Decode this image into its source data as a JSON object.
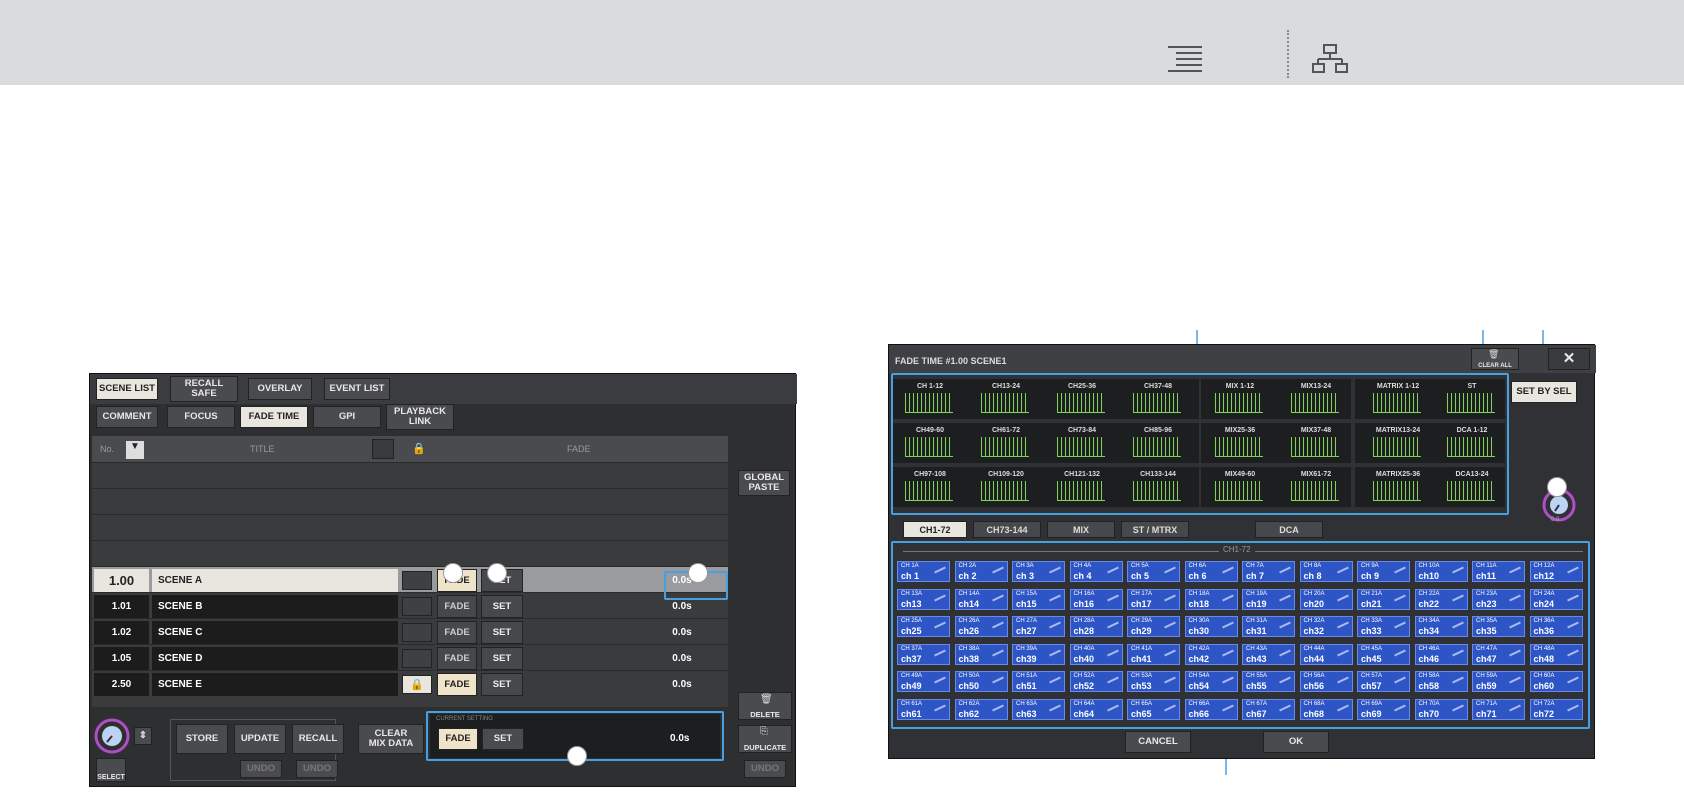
{
  "left": {
    "tabs": [
      "SCENE LIST",
      "RECALL\nSAFE",
      "OVERLAY",
      "EVENT LIST"
    ],
    "subtabs": [
      "COMMENT",
      "FOCUS",
      "FADE TIME",
      "GPI",
      "PLAYBACK\nLINK"
    ],
    "header": {
      "no": "No.",
      "title": "TITLE",
      "fade": "FADE"
    },
    "global_paste": "GLOBAL\nPASTE",
    "rows": [
      {
        "num": "1.00",
        "title": "SCENE A",
        "fade": "FADE",
        "set": "SET",
        "time": "0.0s"
      },
      {
        "num": "1.01",
        "title": "SCENE B",
        "fade": "FADE",
        "set": "SET",
        "time": "0.0s"
      },
      {
        "num": "1.02",
        "title": "SCENE C",
        "fade": "FADE",
        "set": "SET",
        "time": "0.0s"
      },
      {
        "num": "1.05",
        "title": "SCENE D",
        "fade": "FADE",
        "set": "SET",
        "time": "0.0s"
      },
      {
        "num": "2.50",
        "title": "SCENE E",
        "fade": "FADE",
        "set": "SET",
        "time": "0.0s"
      }
    ],
    "bottom": {
      "store": "STORE",
      "update": "UPDATE",
      "recall": "RECALL",
      "undo": "UNDO",
      "clear": "CLEAR\nMIX DATA",
      "current": "CURRENT SETTING",
      "fade": "FADE",
      "set": "SET",
      "time": "0.0s",
      "delete": "DELETE",
      "duplicate": "DUPLICATE",
      "select": "SELECT"
    }
  },
  "dialog": {
    "title": "FADE TIME #1.00 SCENE1",
    "clear_all": "CLEAR ALL",
    "close": "✕",
    "set_by_sel": "SET BY SEL",
    "knob_value": "0.0",
    "groups": [
      [
        "CH 1-12",
        "CH13-24",
        "CH25-36",
        "CH37-48"
      ],
      [
        "CH49-60",
        "CH61-72",
        "CH73-84",
        "CH85-96"
      ],
      [
        "CH97-108",
        "CH109-120",
        "CH121-132",
        "CH133-144"
      ]
    ],
    "mix": [
      [
        "MIX 1-12",
        "MIX13-24"
      ],
      [
        "MIX25-36",
        "MIX37-48"
      ],
      [
        "MIX49-60",
        "MIX61-72"
      ]
    ],
    "matrix": [
      [
        "MATRIX 1-12",
        "ST"
      ],
      [
        "MATRIX13-24",
        "DCA 1-12"
      ],
      [
        "MATRIX25-36",
        "DCA13-24"
      ]
    ],
    "tabs": [
      "CH1-72",
      "CH73-144",
      "MIX",
      "ST / MTRX",
      "DCA"
    ],
    "section": "CH1-72",
    "cancel": "CANCEL",
    "ok": "OK"
  }
}
